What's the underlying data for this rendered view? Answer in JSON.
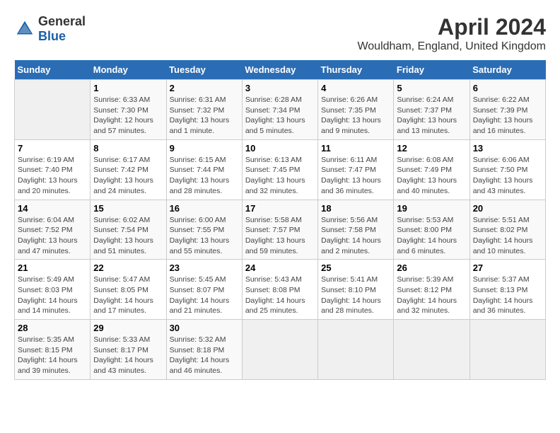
{
  "header": {
    "logo_general": "General",
    "logo_blue": "Blue",
    "month_year": "April 2024",
    "location": "Wouldham, England, United Kingdom"
  },
  "days_of_week": [
    "Sunday",
    "Monday",
    "Tuesday",
    "Wednesday",
    "Thursday",
    "Friday",
    "Saturday"
  ],
  "weeks": [
    [
      {
        "day": "",
        "info": ""
      },
      {
        "day": "1",
        "info": "Sunrise: 6:33 AM\nSunset: 7:30 PM\nDaylight: 12 hours\nand 57 minutes."
      },
      {
        "day": "2",
        "info": "Sunrise: 6:31 AM\nSunset: 7:32 PM\nDaylight: 13 hours\nand 1 minute."
      },
      {
        "day": "3",
        "info": "Sunrise: 6:28 AM\nSunset: 7:34 PM\nDaylight: 13 hours\nand 5 minutes."
      },
      {
        "day": "4",
        "info": "Sunrise: 6:26 AM\nSunset: 7:35 PM\nDaylight: 13 hours\nand 9 minutes."
      },
      {
        "day": "5",
        "info": "Sunrise: 6:24 AM\nSunset: 7:37 PM\nDaylight: 13 hours\nand 13 minutes."
      },
      {
        "day": "6",
        "info": "Sunrise: 6:22 AM\nSunset: 7:39 PM\nDaylight: 13 hours\nand 16 minutes."
      }
    ],
    [
      {
        "day": "7",
        "info": "Sunrise: 6:19 AM\nSunset: 7:40 PM\nDaylight: 13 hours\nand 20 minutes."
      },
      {
        "day": "8",
        "info": "Sunrise: 6:17 AM\nSunset: 7:42 PM\nDaylight: 13 hours\nand 24 minutes."
      },
      {
        "day": "9",
        "info": "Sunrise: 6:15 AM\nSunset: 7:44 PM\nDaylight: 13 hours\nand 28 minutes."
      },
      {
        "day": "10",
        "info": "Sunrise: 6:13 AM\nSunset: 7:45 PM\nDaylight: 13 hours\nand 32 minutes."
      },
      {
        "day": "11",
        "info": "Sunrise: 6:11 AM\nSunset: 7:47 PM\nDaylight: 13 hours\nand 36 minutes."
      },
      {
        "day": "12",
        "info": "Sunrise: 6:08 AM\nSunset: 7:49 PM\nDaylight: 13 hours\nand 40 minutes."
      },
      {
        "day": "13",
        "info": "Sunrise: 6:06 AM\nSunset: 7:50 PM\nDaylight: 13 hours\nand 43 minutes."
      }
    ],
    [
      {
        "day": "14",
        "info": "Sunrise: 6:04 AM\nSunset: 7:52 PM\nDaylight: 13 hours\nand 47 minutes."
      },
      {
        "day": "15",
        "info": "Sunrise: 6:02 AM\nSunset: 7:54 PM\nDaylight: 13 hours\nand 51 minutes."
      },
      {
        "day": "16",
        "info": "Sunrise: 6:00 AM\nSunset: 7:55 PM\nDaylight: 13 hours\nand 55 minutes."
      },
      {
        "day": "17",
        "info": "Sunrise: 5:58 AM\nSunset: 7:57 PM\nDaylight: 13 hours\nand 59 minutes."
      },
      {
        "day": "18",
        "info": "Sunrise: 5:56 AM\nSunset: 7:58 PM\nDaylight: 14 hours\nand 2 minutes."
      },
      {
        "day": "19",
        "info": "Sunrise: 5:53 AM\nSunset: 8:00 PM\nDaylight: 14 hours\nand 6 minutes."
      },
      {
        "day": "20",
        "info": "Sunrise: 5:51 AM\nSunset: 8:02 PM\nDaylight: 14 hours\nand 10 minutes."
      }
    ],
    [
      {
        "day": "21",
        "info": "Sunrise: 5:49 AM\nSunset: 8:03 PM\nDaylight: 14 hours\nand 14 minutes."
      },
      {
        "day": "22",
        "info": "Sunrise: 5:47 AM\nSunset: 8:05 PM\nDaylight: 14 hours\nand 17 minutes."
      },
      {
        "day": "23",
        "info": "Sunrise: 5:45 AM\nSunset: 8:07 PM\nDaylight: 14 hours\nand 21 minutes."
      },
      {
        "day": "24",
        "info": "Sunrise: 5:43 AM\nSunset: 8:08 PM\nDaylight: 14 hours\nand 25 minutes."
      },
      {
        "day": "25",
        "info": "Sunrise: 5:41 AM\nSunset: 8:10 PM\nDaylight: 14 hours\nand 28 minutes."
      },
      {
        "day": "26",
        "info": "Sunrise: 5:39 AM\nSunset: 8:12 PM\nDaylight: 14 hours\nand 32 minutes."
      },
      {
        "day": "27",
        "info": "Sunrise: 5:37 AM\nSunset: 8:13 PM\nDaylight: 14 hours\nand 36 minutes."
      }
    ],
    [
      {
        "day": "28",
        "info": "Sunrise: 5:35 AM\nSunset: 8:15 PM\nDaylight: 14 hours\nand 39 minutes."
      },
      {
        "day": "29",
        "info": "Sunrise: 5:33 AM\nSunset: 8:17 PM\nDaylight: 14 hours\nand 43 minutes."
      },
      {
        "day": "30",
        "info": "Sunrise: 5:32 AM\nSunset: 8:18 PM\nDaylight: 14 hours\nand 46 minutes."
      },
      {
        "day": "",
        "info": ""
      },
      {
        "day": "",
        "info": ""
      },
      {
        "day": "",
        "info": ""
      },
      {
        "day": "",
        "info": ""
      }
    ]
  ]
}
